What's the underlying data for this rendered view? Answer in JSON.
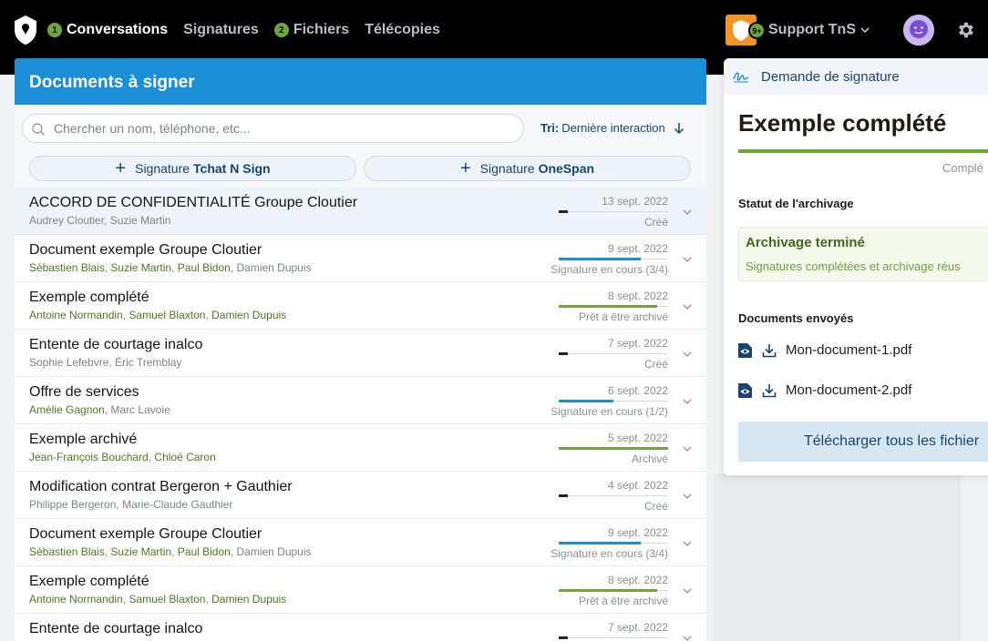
{
  "nav": {
    "items": [
      {
        "label": "Conversations",
        "badge": "1",
        "active": true
      },
      {
        "label": "Signatures",
        "badge": "",
        "active": false
      },
      {
        "label": "Fichiers",
        "badge": "2",
        "active": false
      },
      {
        "label": "Télécopies",
        "badge": "",
        "active": false
      }
    ]
  },
  "org": {
    "name": "Support TnS",
    "badge": "9+"
  },
  "docs": {
    "title": "Documents à signer",
    "search_placeholder": "Chercher un nom, téléphone, etc...",
    "sort_prefix": "Tri:",
    "sort_value": "Dernière interaction",
    "new_buttons": [
      {
        "text": "Signature",
        "brand": "Tchat N Sign"
      },
      {
        "text": "Signature",
        "brand": "OneSpan"
      }
    ],
    "rows": [
      {
        "title": "ACCORD DE CONFIDENTIALITÉ Groupe Cloutier",
        "people": [
          {
            "name": "Audrey Cloutier",
            "signed": false
          },
          {
            "name": "Suzie Martin",
            "signed": false
          }
        ],
        "date": "13 sept. 2022",
        "status": "Créé",
        "progress": 0.08,
        "color": "#222222",
        "selected": true
      },
      {
        "title": "Document exemple Groupe Cloutier",
        "people": [
          {
            "name": "Sébastien Blais",
            "signed": true
          },
          {
            "name": "Suzie Martin",
            "signed": true
          },
          {
            "name": "Paul Bidon",
            "signed": true
          },
          {
            "name": "Damien Dupuis",
            "signed": false
          }
        ],
        "date": "9 sept. 2022",
        "status": "Signature en cours (3/4)",
        "progress": 0.75,
        "color": "#1a8fd8",
        "selected": false
      },
      {
        "title": "Exemple complété",
        "people": [
          {
            "name": "Antoine Normandin",
            "signed": true
          },
          {
            "name": "Samuel Blaxton",
            "signed": true
          },
          {
            "name": "Damien Dupuis",
            "signed": true
          }
        ],
        "date": "8 sept. 2022",
        "status": "Prêt à être archivé",
        "progress": 0.9,
        "color": "#6da73a",
        "selected": false
      },
      {
        "title": "Entente de courtage inalco",
        "people": [
          {
            "name": "Sophie Lefebvre",
            "signed": false
          },
          {
            "name": "Éric Tremblay",
            "signed": false
          }
        ],
        "date": "7 sept. 2022",
        "status": "Créé",
        "progress": 0.08,
        "color": "#222222",
        "selected": false
      },
      {
        "title": "Offre de services",
        "people": [
          {
            "name": "Amélie Gagnon",
            "signed": true
          },
          {
            "name": "Marc Lavoie",
            "signed": false
          }
        ],
        "date": "6 sept. 2022",
        "status": "Signature en cours (1/2)",
        "progress": 0.5,
        "color": "#1a8fd8",
        "selected": false
      },
      {
        "title": "Exemple archivé",
        "people": [
          {
            "name": "Jean-François Bouchard",
            "signed": true
          },
          {
            "name": "Chloé Caron",
            "signed": true
          }
        ],
        "date": "5 sept. 2022",
        "status": "Archivé",
        "progress": 1.0,
        "color": "#6da73a",
        "selected": false
      },
      {
        "title": "Modification contrat Bergeron + Gauthier",
        "people": [
          {
            "name": "Philippe Bergeron",
            "signed": false
          },
          {
            "name": "Marie-Claude Gauthier",
            "signed": false
          }
        ],
        "date": "4 sept. 2022",
        "status": "Créé",
        "progress": 0.08,
        "color": "#222222",
        "selected": false
      },
      {
        "title": "Document exemple Groupe Cloutier",
        "people": [
          {
            "name": "Sébastien Blais",
            "signed": true
          },
          {
            "name": "Suzie Martin",
            "signed": true
          },
          {
            "name": "Paul Bidon",
            "signed": true
          },
          {
            "name": "Damien Dupuis",
            "signed": false
          }
        ],
        "date": "9 sept. 2022",
        "status": "Signature en cours (3/4)",
        "progress": 0.75,
        "color": "#1a8fd8",
        "selected": false
      },
      {
        "title": "Exemple complété",
        "people": [
          {
            "name": "Antoine Normandin",
            "signed": true
          },
          {
            "name": "Samuel Blaxton",
            "signed": true
          },
          {
            "name": "Damien Dupuis",
            "signed": true
          }
        ],
        "date": "8 sept. 2022",
        "status": "Prêt à être archivé",
        "progress": 0.9,
        "color": "#6da73a",
        "selected": false
      },
      {
        "title": "Entente de courtage inalco",
        "people": [],
        "date": "7 sept. 2022",
        "status": "",
        "progress": 0.08,
        "color": "#222222",
        "selected": false
      }
    ]
  },
  "signature": {
    "header": "Demande de signature",
    "title": "Exemple complété",
    "status": "Complé",
    "progress": 1.0,
    "archive_label": "Statut de l'archivage",
    "archive_title": "Archivage terminé",
    "archive_sub": "Signatures complétées et archivage réus",
    "docs_label": "Documents envoyés",
    "documents": [
      "Mon-document-1.pdf",
      "Mon-document-2.pdf"
    ],
    "download_all": "Télécharger tous les fichier"
  },
  "colors": {
    "accent": "#1a8fd8",
    "green": "#6da73a",
    "orange": "#f29425",
    "navy": "#17456e"
  }
}
